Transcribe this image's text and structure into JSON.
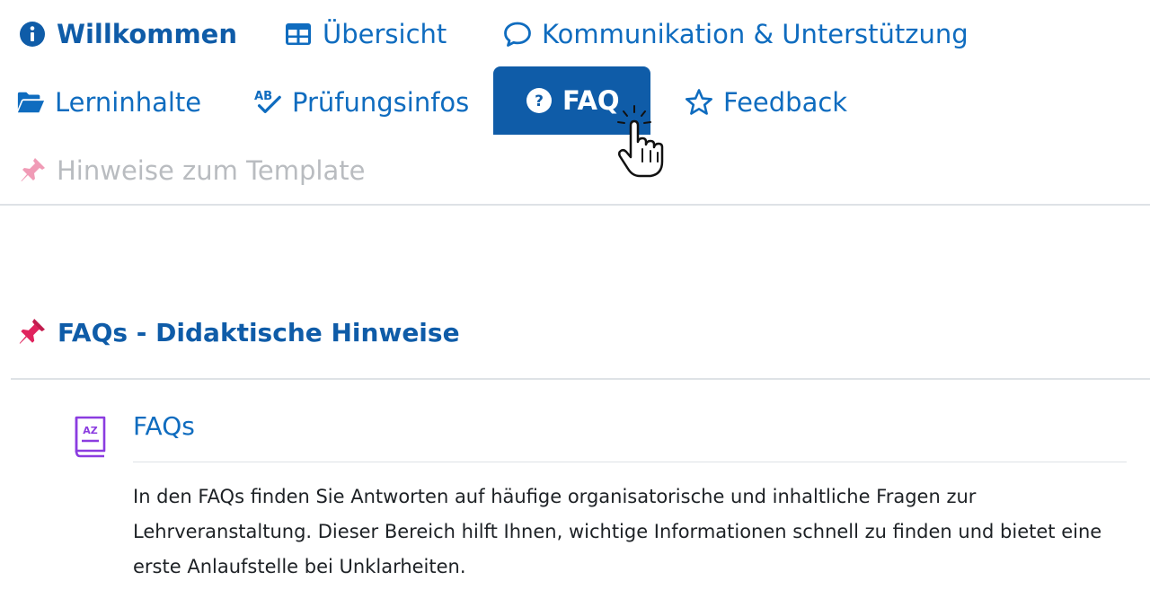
{
  "nav": {
    "tabs": [
      {
        "label": "Willkommen",
        "icon": "info-circle-icon"
      },
      {
        "label": "Übersicht",
        "icon": "table-icon"
      },
      {
        "label": "Kommunikation & Unterstützung",
        "icon": "speech-bubble-icon"
      },
      {
        "label": "Lerninhalte",
        "icon": "folder-open-icon"
      },
      {
        "label": "Prüfungsinfos",
        "icon": "spellcheck-icon"
      },
      {
        "label": "FAQ",
        "icon": "question-circle-icon",
        "active": true
      },
      {
        "label": "Feedback",
        "icon": "star-icon"
      },
      {
        "label": "Hinweise zum Template",
        "icon": "pushpin-icon",
        "disabled": true
      }
    ]
  },
  "section": {
    "title": "FAQs - Didaktische Hinweise",
    "icon": "pushpin-icon"
  },
  "activity": {
    "title": "FAQs",
    "icon": "glossary-book-icon",
    "icon_text": "AZ",
    "description": "In den FAQs finden Sie Antworten auf häufige organisatorische und inhaltliche Fragen zur Lehrveranstaltung. Dieser Bereich hilft Ihnen, wichtige Informationen schnell zu finden und bietet eine erste Anlaufstelle bei Unklarheiten."
  },
  "colors": {
    "primary": "#0f5ca8",
    "link": "#0f6cbf",
    "disabled": "#b9bcc0",
    "pin": "#e0245e",
    "glossary_icon": "#8b3ce0"
  }
}
